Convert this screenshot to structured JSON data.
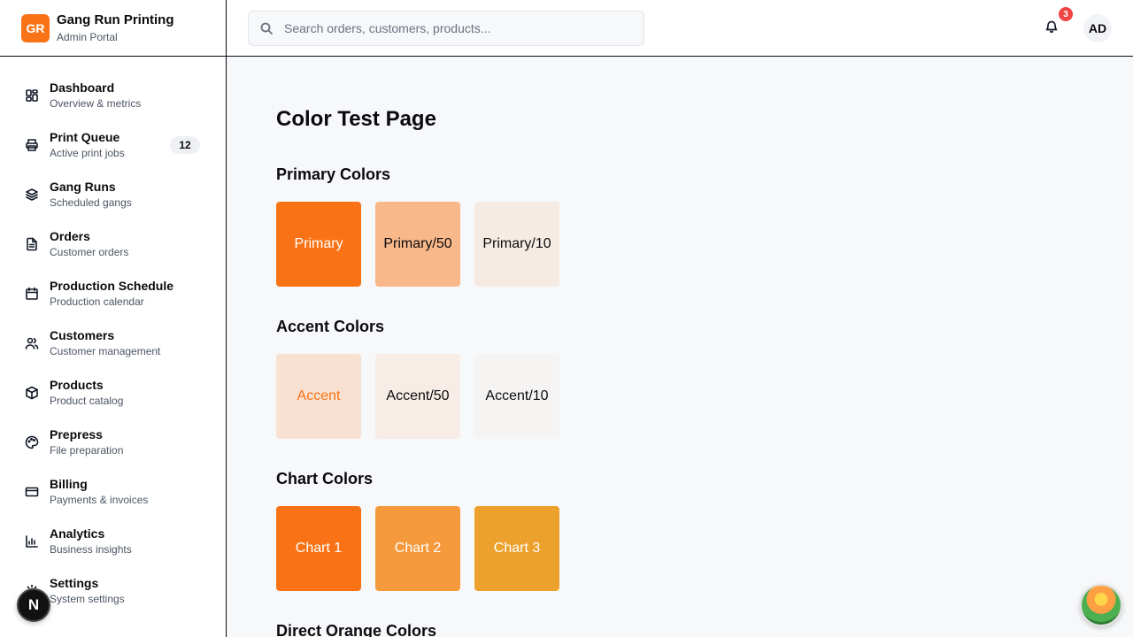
{
  "brand": {
    "logo": "GR",
    "title": "Gang Run Printing",
    "subtitle": "Admin Portal"
  },
  "nav": [
    {
      "label": "Dashboard",
      "desc": "Overview & metrics",
      "icon": "dashboard-icon"
    },
    {
      "label": "Print Queue",
      "desc": "Active print jobs",
      "icon": "printer-icon",
      "badge": "12"
    },
    {
      "label": "Gang Runs",
      "desc": "Scheduled gangs",
      "icon": "layers-icon"
    },
    {
      "label": "Orders",
      "desc": "Customer orders",
      "icon": "file-text-icon"
    },
    {
      "label": "Production Schedule",
      "desc": "Production calendar",
      "icon": "calendar-icon"
    },
    {
      "label": "Customers",
      "desc": "Customer management",
      "icon": "users-icon"
    },
    {
      "label": "Products",
      "desc": "Product catalog",
      "icon": "package-icon"
    },
    {
      "label": "Prepress",
      "desc": "File preparation",
      "icon": "palette-icon"
    },
    {
      "label": "Billing",
      "desc": "Payments & invoices",
      "icon": "credit-card-icon"
    },
    {
      "label": "Analytics",
      "desc": "Business insights",
      "icon": "bar-chart-icon"
    },
    {
      "label": "Settings",
      "desc": "System settings",
      "icon": "gear-icon"
    }
  ],
  "header": {
    "search_placeholder": "Search orders, customers, products...",
    "notification_count": "3",
    "avatar_initials": "AD"
  },
  "main": {
    "title": "Color Test Page",
    "sections": [
      {
        "title": "Primary Colors",
        "swatches": [
          {
            "label": "Primary",
            "bg": "#f97316",
            "fg": "#ffffff"
          },
          {
            "label": "Primary/50",
            "bg": "#f8b88a",
            "fg": "#0b0b0f"
          },
          {
            "label": "Primary/10",
            "bg": "#f6ebe2",
            "fg": "#0b0b0f"
          }
        ]
      },
      {
        "title": "Accent Colors",
        "swatches": [
          {
            "label": "Accent",
            "bg": "#f9e1d1",
            "fg": "#f97316"
          },
          {
            "label": "Accent/50",
            "bg": "#f7ede6",
            "fg": "#0b0b0f"
          },
          {
            "label": "Accent/10",
            "bg": "#f6f4f3",
            "fg": "#0b0b0f"
          }
        ]
      },
      {
        "title": "Chart Colors",
        "swatches": [
          {
            "label": "Chart 1",
            "bg": "#f97316",
            "fg": "#ffffff"
          },
          {
            "label": "Chart 2",
            "bg": "#f59a3c",
            "fg": "#ffffff"
          },
          {
            "label": "Chart 3",
            "bg": "#eda12d",
            "fg": "#ffffff"
          }
        ]
      },
      {
        "title": "Direct Orange Colors",
        "swatches": []
      }
    ]
  },
  "next_logo": "N"
}
